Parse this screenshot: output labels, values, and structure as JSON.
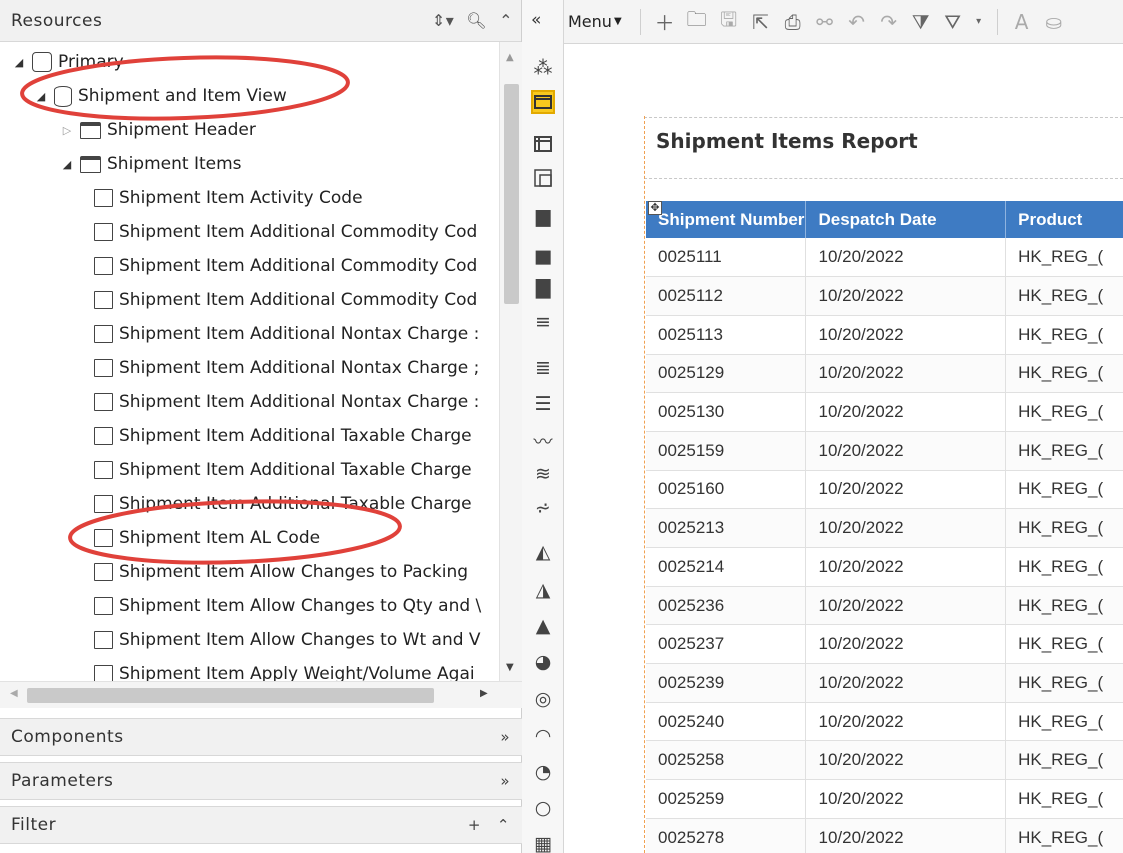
{
  "resources": {
    "title": "Resources",
    "tree": [
      {
        "label": "Primary",
        "level": 0,
        "toggle": "open",
        "icon": "datasource-icon"
      },
      {
        "label": "Shipment and Item View",
        "level": 1,
        "toggle": "open",
        "icon": "database-icon"
      },
      {
        "label": "Shipment Header",
        "level": 2,
        "toggle": "closed",
        "icon": "folder-icon"
      },
      {
        "label": "Shipment Items",
        "level": 2,
        "toggle": "open",
        "icon": "folder-open-icon"
      },
      {
        "label": "Shipment Item Activity Code",
        "level": 3,
        "icon": "field-icon"
      },
      {
        "label": "Shipment Item Additional Commodity Cod",
        "level": 3,
        "icon": "field-icon"
      },
      {
        "label": "Shipment Item Additional Commodity Cod",
        "level": 3,
        "icon": "field-icon"
      },
      {
        "label": "Shipment Item Additional Commodity Cod",
        "level": 3,
        "icon": "field-icon"
      },
      {
        "label": "Shipment Item Additional Nontax Charge :",
        "level": 3,
        "icon": "field-icon"
      },
      {
        "label": "Shipment Item Additional Nontax Charge ;",
        "level": 3,
        "icon": "field-icon"
      },
      {
        "label": "Shipment Item Additional Nontax Charge :",
        "level": 3,
        "icon": "field-icon"
      },
      {
        "label": "Shipment Item Additional Taxable Charge",
        "level": 3,
        "icon": "field-icon"
      },
      {
        "label": "Shipment Item Additional Taxable Charge",
        "level": 3,
        "icon": "field-icon"
      },
      {
        "label": "Shipment Item Additional Taxable Charge",
        "level": 3,
        "icon": "field-icon"
      },
      {
        "label": "Shipment Item AL Code",
        "level": 3,
        "icon": "field-icon"
      },
      {
        "label": "Shipment Item Allow Changes to Packing",
        "level": 3,
        "icon": "field-icon"
      },
      {
        "label": "Shipment Item Allow Changes to Qty and \\",
        "level": 3,
        "icon": "field-icon"
      },
      {
        "label": "Shipment Item Allow Changes to Wt and V",
        "level": 3,
        "icon": "field-icon"
      },
      {
        "label": "Shipment Item Apply Weight/Volume Agai",
        "level": 3,
        "icon": "field-icon"
      }
    ]
  },
  "sections": {
    "components": "Components",
    "parameters": "Parameters",
    "filter": "Filter"
  },
  "toolbar": {
    "menu_label": "Menu"
  },
  "report": {
    "title": "Shipment Items Report",
    "columns": [
      "Shipment Number",
      "Despatch Date",
      "Product"
    ],
    "rows": [
      [
        "0025111",
        "10/20/2022",
        "HK_REG_("
      ],
      [
        "0025112",
        "10/20/2022",
        "HK_REG_("
      ],
      [
        "0025113",
        "10/20/2022",
        "HK_REG_("
      ],
      [
        "0025129",
        "10/20/2022",
        "HK_REG_("
      ],
      [
        "0025130",
        "10/20/2022",
        "HK_REG_("
      ],
      [
        "0025159",
        "10/20/2022",
        "HK_REG_("
      ],
      [
        "0025160",
        "10/20/2022",
        "HK_REG_("
      ],
      [
        "0025213",
        "10/20/2022",
        "HK_REG_("
      ],
      [
        "0025214",
        "10/20/2022",
        "HK_REG_("
      ],
      [
        "0025236",
        "10/20/2022",
        "HK_REG_("
      ],
      [
        "0025237",
        "10/20/2022",
        "HK_REG_("
      ],
      [
        "0025239",
        "10/20/2022",
        "HK_REG_("
      ],
      [
        "0025240",
        "10/20/2022",
        "HK_REG_("
      ],
      [
        "0025258",
        "10/20/2022",
        "HK_REG_("
      ],
      [
        "0025259",
        "10/20/2022",
        "HK_REG_("
      ],
      [
        "0025278",
        "10/20/2022",
        "HK_REG_("
      ]
    ]
  },
  "colors": {
    "header_blue": "#3e7bc3",
    "selected_tool": "#f8c91e",
    "annotation_red": "#e0413a"
  }
}
